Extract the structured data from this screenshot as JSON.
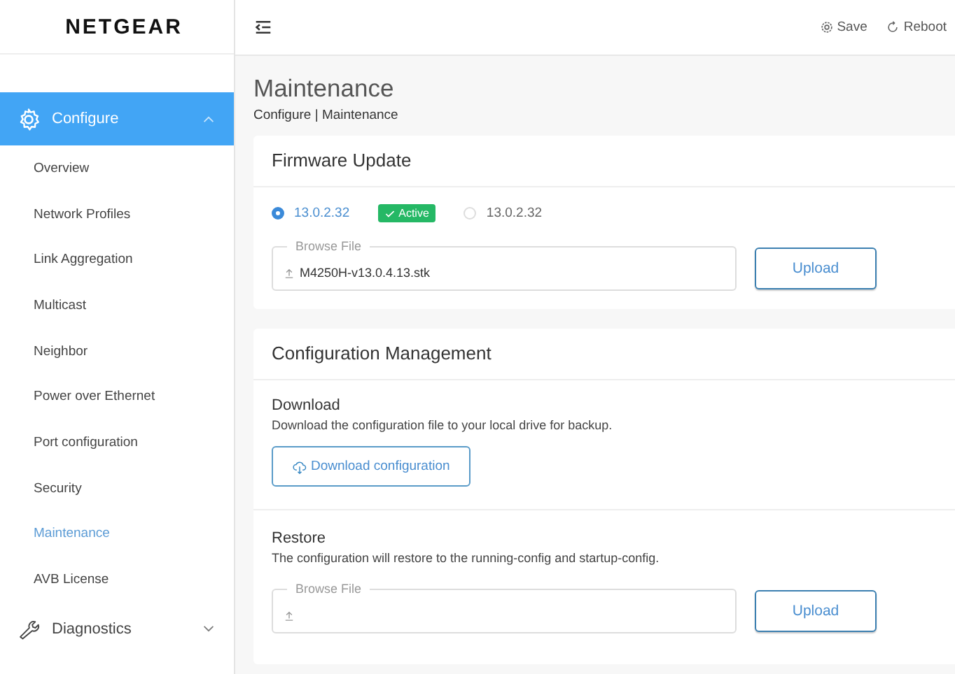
{
  "logo": "NETGEAR",
  "header": {
    "actions": [
      {
        "kind": "save",
        "label": "Save"
      },
      {
        "kind": "reboot",
        "label": "Reboot"
      }
    ]
  },
  "sidebar": {
    "groups": [
      {
        "kind": "configure",
        "label": "Configure",
        "expanded": true,
        "selected": true,
        "children": [
          {
            "label": "Overview",
            "selected": false
          },
          {
            "label": "Network Profiles",
            "selected": false
          },
          {
            "label": "Link Aggregation",
            "selected": false
          },
          {
            "label": "Multicast",
            "selected": false
          },
          {
            "label": "Neighbor",
            "selected": false
          },
          {
            "label": "Power over Ethernet",
            "selected": false
          },
          {
            "label": "Port configuration",
            "selected": false
          },
          {
            "label": "Security",
            "selected": false
          },
          {
            "label": "Maintenance",
            "selected": true
          },
          {
            "label": "AVB License",
            "selected": false
          }
        ]
      },
      {
        "kind": "diagnostics",
        "label": "Diagnostics",
        "expanded": false,
        "selected": false
      }
    ]
  },
  "page": {
    "title": "Maintenance",
    "breadcrumb": "Configure | Maintenance"
  },
  "firmware": {
    "title": "Firmware Update",
    "images": [
      {
        "version": "13.0.2.32",
        "selected": true,
        "badge": "Active"
      },
      {
        "version": "13.0.2.32",
        "selected": false
      }
    ],
    "file_field": {
      "label": "Browse File",
      "value": "M4250H-v13.0.4.13.stk"
    },
    "upload_button": "Upload"
  },
  "config": {
    "title": "Configuration Management",
    "download": {
      "title": "Download",
      "description": "Download the configuration file to your local drive for backup.",
      "button": "Download configuration"
    },
    "restore": {
      "title": "Restore",
      "description": "The configuration will restore to the running-config and startup-config.",
      "file_field": {
        "label": "Browse File"
      },
      "upload_button": "Upload"
    }
  }
}
